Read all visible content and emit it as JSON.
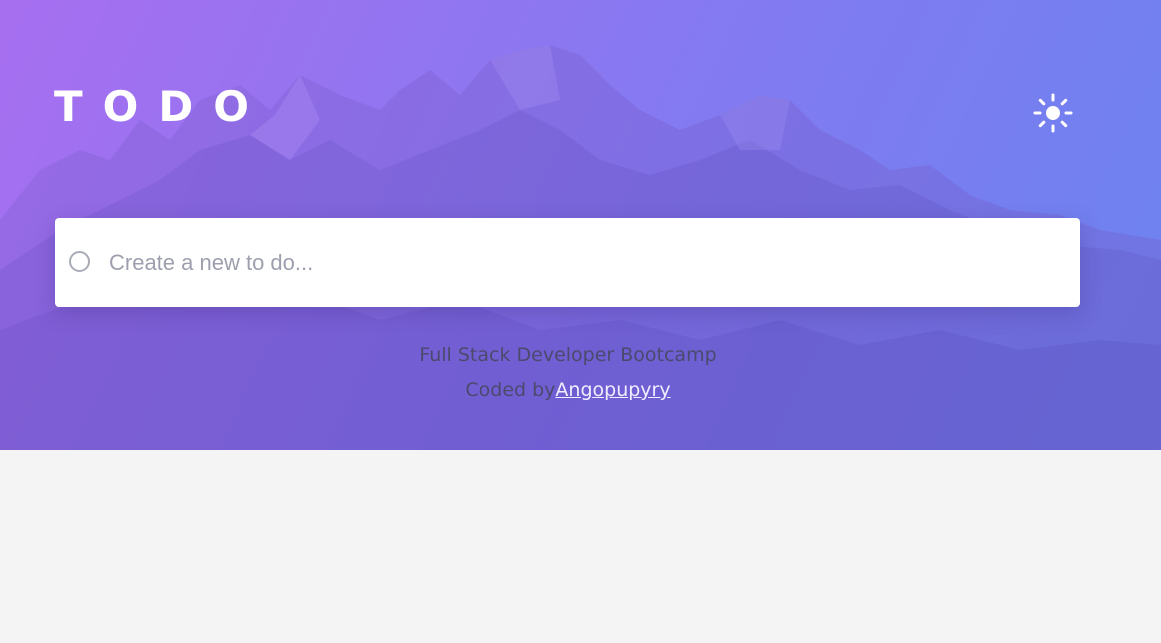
{
  "app": {
    "title": "TODO"
  },
  "header": {
    "theme_toggle_icon": "sun-icon"
  },
  "new_todo": {
    "placeholder": "Create a new to do...",
    "value": "",
    "checkbox_icon": "circle-icon"
  },
  "footer": {
    "line1": "Full Stack Developer Bootcamp",
    "coded_by_prefix": "Coded by",
    "author_link": "Angopupyry"
  },
  "colors": {
    "gradient_start": "#a46ff0",
    "gradient_end": "#6f84ee",
    "page_background": "#f4f4f4",
    "card_background": "#ffffff",
    "placeholder_text": "#9d9fae",
    "footer_text": "#4b4a6e"
  }
}
